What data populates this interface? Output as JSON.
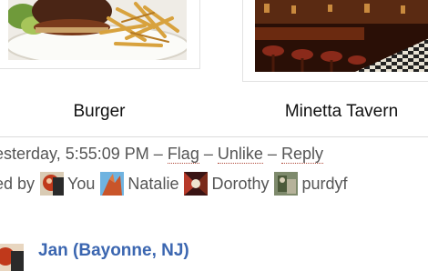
{
  "photos": [
    {
      "caption": "Burger",
      "icon": "burger-photo"
    },
    {
      "caption": "Minetta Tavern",
      "icon": "restaurant-interior-photo"
    }
  ],
  "comment_meta": {
    "timestamp": "esterday, 5:55:09 PM",
    "sep1": "–",
    "flag": "Flag",
    "sep2": "–",
    "unlike": "Unlike",
    "sep3": "–",
    "reply": "Reply"
  },
  "likes": {
    "prefix": "ed by",
    "likers": [
      {
        "name": "You",
        "icon": "you-avatar"
      },
      {
        "name": "Natalie",
        "icon": "natalie-avatar"
      },
      {
        "name": "Dorothy",
        "icon": "dorothy-avatar"
      },
      {
        "name": "purdyf",
        "icon": "purdyf-avatar"
      }
    ]
  },
  "next_comment": {
    "author": "Jan (Bayonne, NJ)",
    "link_color": "#3b66b0"
  }
}
